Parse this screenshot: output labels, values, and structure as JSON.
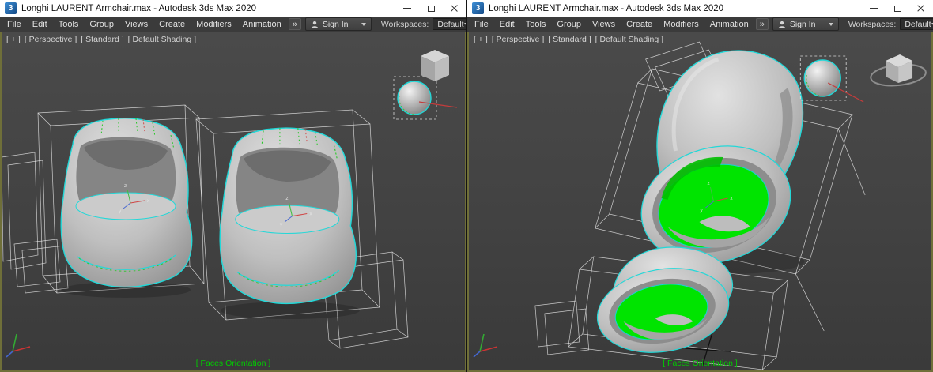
{
  "colors": {
    "selection_outline_cyan": "#23d8d8",
    "flipped_normals_green": "#00e400",
    "status_text_green": "#00cc00",
    "viewport_border_olive": "#6f6f39",
    "menubar_bg": "#3b3b3b",
    "titlebar_bg": "#ffffff"
  },
  "icons": {
    "app": "3ds-max-logo",
    "app_glyph": "3",
    "user": "user-icon",
    "dropdown": "chevron-down-icon",
    "minimize": "minimize-icon",
    "maximize": "maximize-icon",
    "close": "close-icon"
  },
  "axis_labels": {
    "x": "x",
    "y": "y",
    "z": "z"
  },
  "windows": [
    {
      "title": "Longhi LAURENT Armchair.max - Autodesk 3ds Max 2020",
      "menu": {
        "items": [
          "File",
          "Edit",
          "Tools",
          "Group",
          "Views",
          "Create",
          "Modifiers",
          "Animation"
        ],
        "overflow": "»"
      },
      "account": {
        "sign_in": "Sign In"
      },
      "workspaces": {
        "label": "Workspaces:",
        "value": "Default"
      },
      "viewport": {
        "menus": [
          "[ + ]",
          "[ Perspective ]",
          "[ Standard ]",
          "[ Default Shading ]"
        ],
        "status": "[ Faces Orientation ]"
      }
    },
    {
      "title": "Longhi LAURENT Armchair.max - Autodesk 3ds Max 2020",
      "menu": {
        "items": [
          "File",
          "Edit",
          "Tools",
          "Group",
          "Views",
          "Create",
          "Modifiers",
          "Animation"
        ],
        "overflow": "»"
      },
      "account": {
        "sign_in": "Sign In"
      },
      "workspaces": {
        "label": "Workspaces:",
        "value": "Default"
      },
      "viewport": {
        "menus": [
          "[ + ]",
          "[ Perspective ]",
          "[ Standard ]",
          "[ Default Shading ]"
        ],
        "status": "[ Faces Orientation ]"
      }
    }
  ]
}
